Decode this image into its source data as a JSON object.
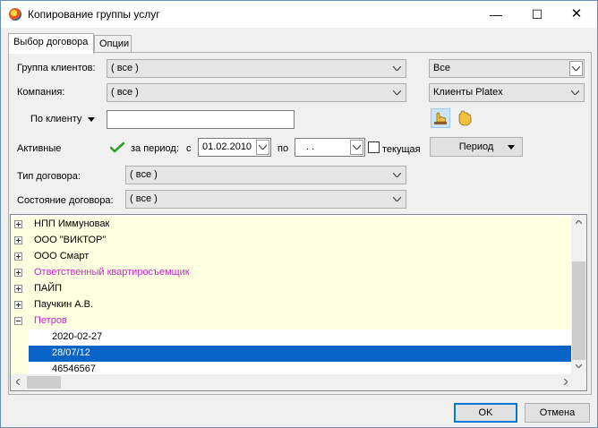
{
  "window": {
    "title": "Копирование группы услуг",
    "minimize": "—",
    "maximize": "☐",
    "close": "✕"
  },
  "tabs": [
    {
      "label": "Выбор договора"
    },
    {
      "label": "Опции"
    }
  ],
  "filters": {
    "client_group_label": "Группа клиентов:",
    "client_group_value": "( все )",
    "client_group_right_value": "Все",
    "company_label": "Компания:",
    "company_value": "( все )",
    "company_right_value": "Клиенты Platex",
    "by_client_label": "По клиенту",
    "by_client_value": "",
    "active_label": "Активные",
    "period_label": "за период:",
    "from_label": "с",
    "from_value": "01.02.2010",
    "to_label": "по",
    "to_value": ". .",
    "current_label": "текущая",
    "current_checked": false,
    "period_button": "Период",
    "contract_type_label": "Тип договора:",
    "contract_type_value": "( все )",
    "contract_state_label": "Состояние договора:",
    "contract_state_value": "( все )"
  },
  "tree": {
    "rows": [
      {
        "text": "НПП Иммуновак",
        "expander": "plus",
        "color": "normal",
        "level": 0
      },
      {
        "text": "ООО \"ВИКТОР\"",
        "expander": "plus",
        "color": "normal",
        "level": 0
      },
      {
        "text": "ООО Смарт",
        "expander": "plus",
        "color": "normal",
        "level": 0
      },
      {
        "text": "Ответственный квартиросъемщик",
        "expander": "plus",
        "color": "pink",
        "level": 0
      },
      {
        "text": "ПАЙП",
        "expander": "plus",
        "color": "normal",
        "level": 0
      },
      {
        "text": "Паучкин А.В.",
        "expander": "plus",
        "color": "normal",
        "level": 0
      },
      {
        "text": "Петров",
        "expander": "minus",
        "color": "pink",
        "level": 0
      },
      {
        "text": "2020-02-27",
        "expander": "none",
        "color": "normal",
        "level": 1
      },
      {
        "text": "28/07/12",
        "expander": "none",
        "color": "normal",
        "level": 1,
        "selected": true
      },
      {
        "text": "46546567",
        "expander": "none",
        "color": "normal",
        "level": 1
      }
    ]
  },
  "buttons": {
    "ok": "OK",
    "cancel": "Отмена"
  },
  "colors": {
    "selection": "#0a64c8",
    "pink_text": "#d11fd1",
    "row_highlight": "#ffffe1",
    "check": "#2e9e2e"
  }
}
